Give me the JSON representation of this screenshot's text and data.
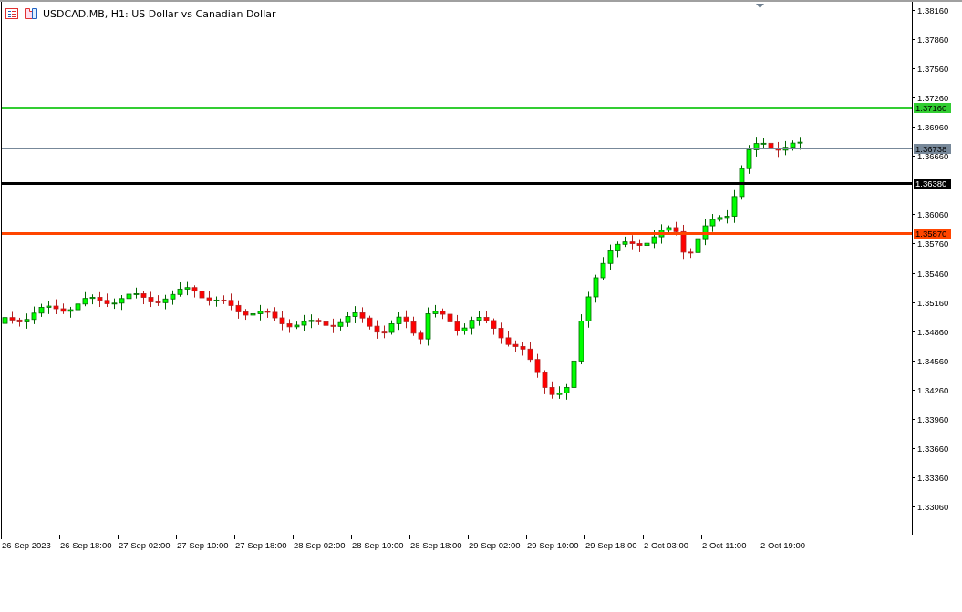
{
  "chart_header": {
    "title": "USDCAD.MB, H1:  US Dollar vs Canadian Dollar"
  },
  "price_axis": {
    "ticks": [
      "1.38160",
      "1.37860",
      "1.37560",
      "1.37260",
      "1.36960",
      "1.36660",
      "1.36060",
      "1.35760",
      "1.35460",
      "1.35160",
      "1.34860",
      "1.34560",
      "1.34260",
      "1.33960",
      "1.33660",
      "1.33360",
      "1.33060"
    ]
  },
  "time_axis": {
    "labels": [
      "26 Sep 2023",
      "26 Sep 18:00",
      "27 Sep 02:00",
      "27 Sep 10:00",
      "27 Sep 18:00",
      "28 Sep 02:00",
      "28 Sep 10:00",
      "28 Sep 18:00",
      "29 Sep 02:00",
      "29 Sep 10:00",
      "29 Sep 18:00",
      "2 Oct 03:00",
      "2 Oct 11:00",
      "2 Oct 19:00"
    ]
  },
  "levels": [
    {
      "kind": "level",
      "price": "1.37160",
      "color": "#32cd32"
    },
    {
      "kind": "bid",
      "price": "1.36738",
      "color": "#778899"
    },
    {
      "kind": "level",
      "price": "1.36380",
      "color": "#000000"
    },
    {
      "kind": "level",
      "price": "1.35870",
      "color": "#ff4500"
    }
  ]
}
